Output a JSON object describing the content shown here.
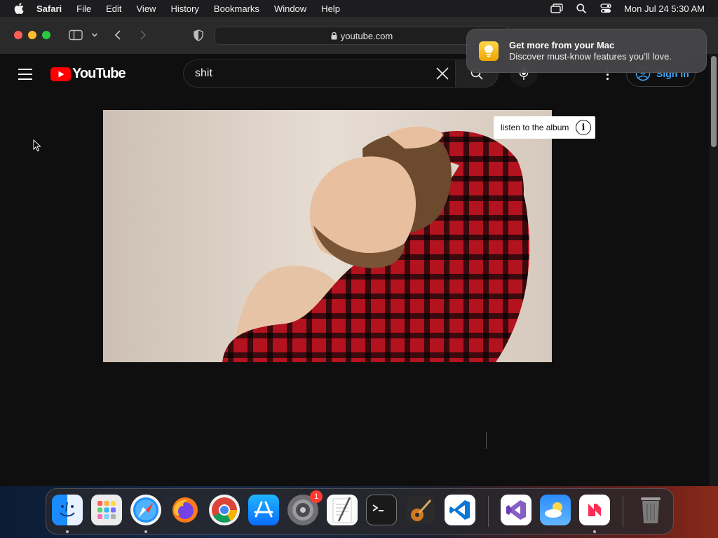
{
  "menubar": {
    "app_name": "Safari",
    "items": [
      "File",
      "Edit",
      "View",
      "History",
      "Bookmarks",
      "Window",
      "Help"
    ],
    "clock": "Mon Jul 24  5:30 AM",
    "status_icons": [
      "screen-mirroring-icon",
      "spotlight-search-icon",
      "control-center-icon"
    ]
  },
  "browser": {
    "url": "youtube.com"
  },
  "youtube": {
    "logo_text": "YouTube",
    "search": {
      "value": "shit",
      "placeholder": "Search"
    },
    "signin_label": "Sign in",
    "overlay_chip": "listen to the album",
    "info_glyph": "i"
  },
  "notification": {
    "title": "Get more from your Mac",
    "body": "Discover must-know features you’ll love."
  },
  "dock": {
    "apps": [
      "Finder",
      "Launchpad",
      "Safari",
      "Firefox",
      "Google Chrome",
      "App Store",
      "System Settings",
      "TextEdit",
      "Terminal",
      "GarageBand",
      "Visual Studio Code",
      "Visual Studio",
      "Weather",
      "News",
      "Trash"
    ],
    "system_settings_badge": "1"
  },
  "colors": {
    "accent_blue": "#3ea6ff",
    "youtube_red": "#ff0000",
    "page_bg": "#0f0f0f"
  }
}
